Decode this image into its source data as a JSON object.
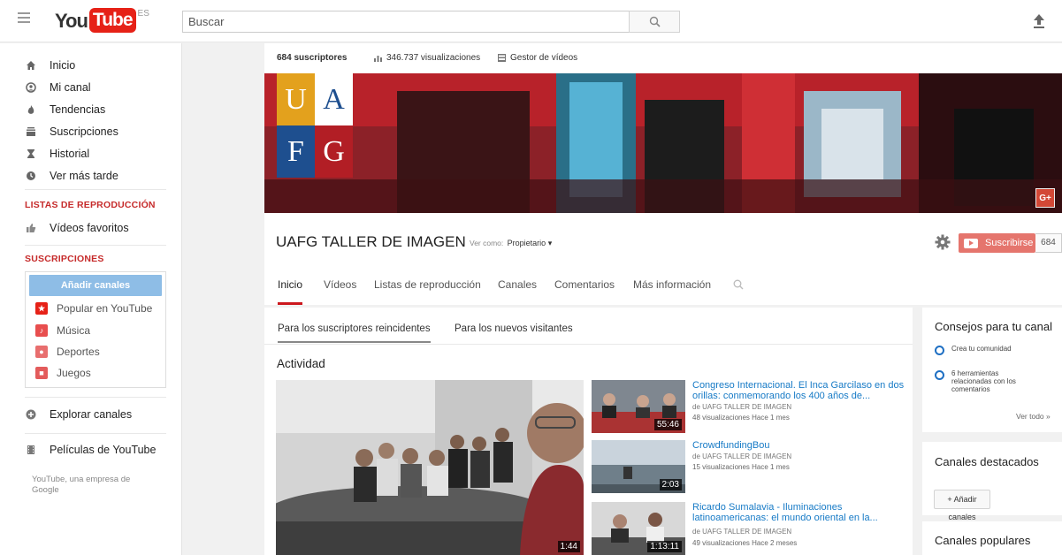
{
  "header": {
    "logo_you": "You",
    "logo_tube": "Tube",
    "logo_region": "ES",
    "search_placeholder": "Buscar"
  },
  "sidebar": {
    "nav": [
      {
        "label": "Inicio",
        "icon": "home-icon"
      },
      {
        "label": "Mi canal",
        "icon": "user-icon"
      },
      {
        "label": "Tendencias",
        "icon": "flame-icon"
      },
      {
        "label": "Suscripciones",
        "icon": "subscriptions-icon"
      },
      {
        "label": "Historial",
        "icon": "hourglass-icon"
      },
      {
        "label": "Ver más tarde",
        "icon": "clock-icon"
      }
    ],
    "playlists_heading": "LISTAS DE REPRODUCCIÓN",
    "favorites_label": "Vídeos favoritos",
    "subscriptions_heading": "SUSCRIPCIONES",
    "add_channels_label": "Añadir canales",
    "subscriptions": [
      {
        "label": "Popular en YouTube",
        "color": "#e62117"
      },
      {
        "label": "Música",
        "color": "#e84e4e"
      },
      {
        "label": "Deportes",
        "color": "#e86e6e"
      },
      {
        "label": "Juegos",
        "color": "#e35b5b"
      }
    ],
    "explore_label": "Explorar canales",
    "movies_label": "Películas de YouTube",
    "footer": "YouTube, una empresa de Google"
  },
  "channel": {
    "subscribers": "684 suscriptores",
    "views": "346.737 visualizaciones",
    "video_manager": "Gestor de vídeos",
    "banner_logo_letters": [
      "U",
      "A",
      "F",
      "G"
    ],
    "gplus_label": "G+",
    "title": "UAFG TALLER DE IMAGEN",
    "view_as_label": "Ver como:",
    "view_as_value": "Propietario",
    "subscribe_label": "Suscribirse",
    "subscribe_count": "684",
    "tabs": [
      "Inicio",
      "Vídeos",
      "Listas de reproducción",
      "Canales",
      "Comentarios",
      "Más información"
    ],
    "subtabs": [
      "Para los suscriptores reincidentes",
      "Para los nuevos visitantes"
    ],
    "activity_heading": "Actividad",
    "featured_duration": "1:44",
    "videos": [
      {
        "title": "Congreso Internacional. El Inca Garcilaso en dos orillas: conmemorando los 400 años de...",
        "by": "de UAFG TALLER DE IMAGEN",
        "meta": "48 visualizaciones   Hace 1 mes",
        "duration": "55:46"
      },
      {
        "title": "CrowdfundingBou",
        "by": "de UAFG TALLER DE IMAGEN",
        "meta": "15 visualizaciones   Hace 1 mes",
        "duration": "2:03"
      },
      {
        "title": "Ricardo Sumalavia - Iluminaciones latinoamericanas: el mundo oriental en la...",
        "by": "de UAFG TALLER DE IMAGEN",
        "meta": "49 visualizaciones   Hace 2 meses",
        "duration": "1:13:11"
      }
    ]
  },
  "right": {
    "tips_title": "Consejos para tu canal",
    "tips": [
      "Crea tu comunidad",
      "6 herramientas relacionadas con los comentarios"
    ],
    "see_all": "Ver todo  »",
    "featured_title": "Canales destacados",
    "add_channels": "+ Añadir canales",
    "popular_title": "Canales populares"
  },
  "colors": {
    "brand_red": "#e62117",
    "link_blue": "#167ac6",
    "subscribe": "#e5756d",
    "banner": "#7b1f24"
  }
}
